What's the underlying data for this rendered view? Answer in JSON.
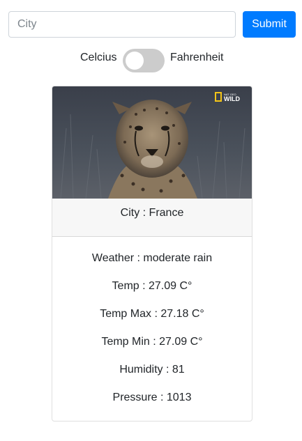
{
  "search": {
    "value": "",
    "placeholder": "City",
    "submit_label": "Submit"
  },
  "units": {
    "left_label": "Celcius",
    "right_label": "Fahrenheit",
    "toggle_on": false
  },
  "card": {
    "image_logo_line1": "NAT GEO",
    "image_logo_line2": "WILD",
    "header": "City : France",
    "details": [
      "Weather : moderate rain",
      "Temp : 27.09 C°",
      "Temp Max : 27.18 C°",
      "Temp Min : 27.09 C°",
      "Humidity : 81",
      "Pressure : 1013"
    ]
  },
  "colors": {
    "primary": "#007bff",
    "toggle_off": "#cccccc",
    "logo_yellow": "#f5c518"
  }
}
